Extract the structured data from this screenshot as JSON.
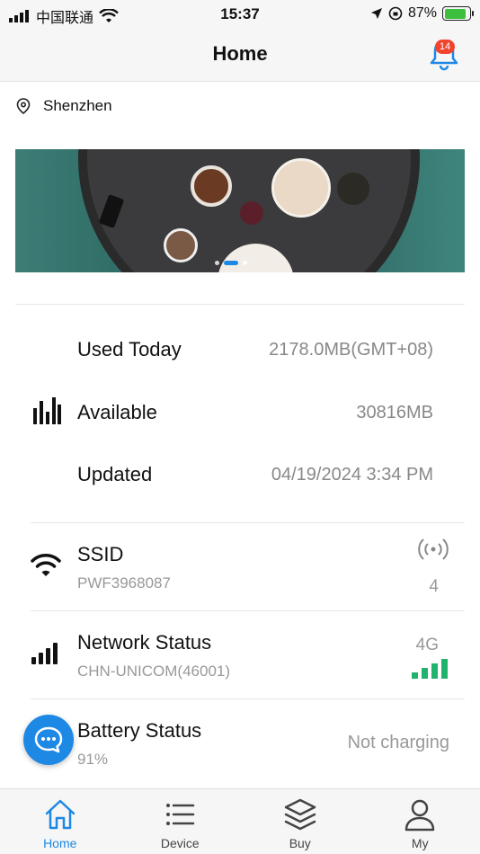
{
  "status_bar": {
    "carrier": "中国联通",
    "time": "15:37",
    "battery_percent": "87%",
    "battery_level": 0.87
  },
  "header": {
    "title": "Home",
    "notification_count": "14"
  },
  "location": {
    "city": "Shenzhen"
  },
  "banner": {
    "slide_count": 3,
    "active_slide": 1
  },
  "usage": {
    "used_today_label": "Used Today",
    "used_today_value": "2178.0MB(GMT+08)",
    "available_label": "Available",
    "available_value": "30816MB",
    "updated_label": "Updated",
    "updated_value": "04/19/2024 3:34 PM"
  },
  "ssid": {
    "title": "SSID",
    "name": "PWF3968087",
    "connected_devices": "4"
  },
  "network": {
    "title": "Network Status",
    "operator": "CHN-UNICOM(46001)",
    "type": "4G",
    "signal_bars": 4
  },
  "battery": {
    "title": "Battery Status",
    "level": "91%",
    "charging_status": "Not charging"
  },
  "tabs": [
    {
      "label": "Home",
      "icon": "home-icon",
      "active": true
    },
    {
      "label": "Device",
      "icon": "list-icon",
      "active": false
    },
    {
      "label": "Buy",
      "icon": "layers-icon",
      "active": false
    },
    {
      "label": "My",
      "icon": "user-icon",
      "active": false
    }
  ],
  "colors": {
    "accent": "#1e88e5",
    "signal_green": "#1fb36b",
    "badge_red": "#f0442f"
  }
}
